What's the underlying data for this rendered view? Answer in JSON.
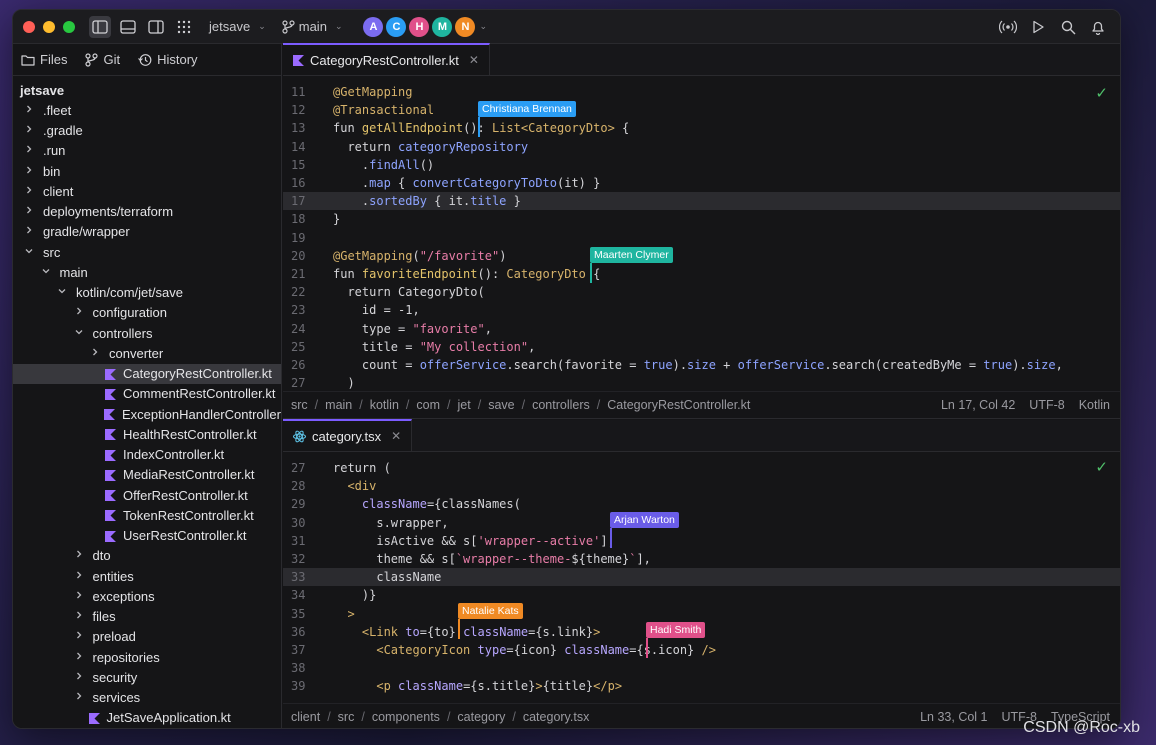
{
  "titlebar": {
    "project": "jetsave",
    "branch": "main",
    "avatars": [
      {
        "letter": "A",
        "color": "#7b6cf0"
      },
      {
        "letter": "C",
        "color": "#2a9df4"
      },
      {
        "letter": "H",
        "color": "#e0508a"
      },
      {
        "letter": "M",
        "color": "#1fb5a0"
      },
      {
        "letter": "N",
        "color": "#f08a24"
      }
    ],
    "icons_left": [
      "sidebar-left-icon",
      "panel-bottom-icon",
      "sidebar-right-icon",
      "grid-icon"
    ],
    "icons_right": [
      "broadcast-icon",
      "run-icon",
      "search-icon",
      "bell-icon"
    ]
  },
  "sidebar": {
    "tabs": [
      {
        "label": "Files",
        "icon": "folder-icon"
      },
      {
        "label": "Git",
        "icon": "git-branch-icon"
      },
      {
        "label": "History",
        "icon": "history-icon"
      }
    ],
    "root": "jetsave",
    "tree": [
      {
        "label": ".fleet",
        "depth": 0,
        "kind": "folder",
        "open": false
      },
      {
        "label": ".gradle",
        "depth": 0,
        "kind": "folder",
        "open": false
      },
      {
        "label": ".run",
        "depth": 0,
        "kind": "folder",
        "open": false
      },
      {
        "label": "bin",
        "depth": 0,
        "kind": "folder",
        "open": false
      },
      {
        "label": "client",
        "depth": 0,
        "kind": "folder",
        "open": false
      },
      {
        "label": "deployments/terraform",
        "depth": 0,
        "kind": "folder",
        "open": false
      },
      {
        "label": "gradle/wrapper",
        "depth": 0,
        "kind": "folder",
        "open": false
      },
      {
        "label": "src",
        "depth": 0,
        "kind": "folder",
        "open": true
      },
      {
        "label": "main",
        "depth": 1,
        "kind": "folder",
        "open": true
      },
      {
        "label": "kotlin/com/jet/save",
        "depth": 2,
        "kind": "folder",
        "open": true
      },
      {
        "label": "configuration",
        "depth": 3,
        "kind": "folder",
        "open": false
      },
      {
        "label": "controllers",
        "depth": 3,
        "kind": "folder",
        "open": true
      },
      {
        "label": "converter",
        "depth": 4,
        "kind": "folder",
        "open": false
      },
      {
        "label": "CategoryRestController.kt",
        "depth": 4,
        "kind": "kt",
        "selected": true
      },
      {
        "label": "CommentRestController.kt",
        "depth": 4,
        "kind": "kt"
      },
      {
        "label": "ExceptionHandlerController",
        "depth": 4,
        "kind": "kt"
      },
      {
        "label": "HealthRestController.kt",
        "depth": 4,
        "kind": "kt"
      },
      {
        "label": "IndexController.kt",
        "depth": 4,
        "kind": "kt"
      },
      {
        "label": "MediaRestController.kt",
        "depth": 4,
        "kind": "kt"
      },
      {
        "label": "OfferRestController.kt",
        "depth": 4,
        "kind": "kt"
      },
      {
        "label": "TokenRestController.kt",
        "depth": 4,
        "kind": "kt"
      },
      {
        "label": "UserRestController.kt",
        "depth": 4,
        "kind": "kt"
      },
      {
        "label": "dto",
        "depth": 3,
        "kind": "folder",
        "open": false
      },
      {
        "label": "entities",
        "depth": 3,
        "kind": "folder",
        "open": false
      },
      {
        "label": "exceptions",
        "depth": 3,
        "kind": "folder",
        "open": false
      },
      {
        "label": "files",
        "depth": 3,
        "kind": "folder",
        "open": false
      },
      {
        "label": "preload",
        "depth": 3,
        "kind": "folder",
        "open": false
      },
      {
        "label": "repositories",
        "depth": 3,
        "kind": "folder",
        "open": false
      },
      {
        "label": "security",
        "depth": 3,
        "kind": "folder",
        "open": false
      },
      {
        "label": "services",
        "depth": 3,
        "kind": "folder",
        "open": false
      },
      {
        "label": "JetSaveApplication.kt",
        "depth": 3,
        "kind": "kt"
      }
    ]
  },
  "editor_top": {
    "tab": "CategoryRestController.kt",
    "current_line": 17,
    "lines": [
      {
        "n": "11",
        "html": "<span class=\"an\">@GetMapping</span>"
      },
      {
        "n": "12",
        "html": "<span class=\"an\">@Transactional</span>"
      },
      {
        "n": "13",
        "html": "fun <span class=\"fn\">getAllEndpoint</span>(): <span class=\"ty\">List&lt;CategoryDto&gt;</span> {"
      },
      {
        "n": "14",
        "html": "  return <span class=\"pr\">categoryRepository</span>"
      },
      {
        "n": "15",
        "html": "    .<span class=\"pr\">findAll</span>()"
      },
      {
        "n": "16",
        "html": "    .<span class=\"pr\">map</span> { <span class=\"pr\">convertCategoryToDto</span>(it) }"
      },
      {
        "n": "17",
        "html": "    .<span class=\"pr\">sortedBy</span> { it.<span class=\"pr\">title</span> }"
      },
      {
        "n": "18",
        "html": "}"
      },
      {
        "n": "19",
        "html": ""
      },
      {
        "n": "20",
        "html": "<span class=\"an\">@GetMapping</span>(<span class=\"st\">\"/favorite\"</span>)"
      },
      {
        "n": "21",
        "html": "fun <span class=\"fn\">favoriteEndpoint</span>(): <span class=\"ty\">CategoryDto</span> {"
      },
      {
        "n": "22",
        "html": "  return CategoryDto("
      },
      {
        "n": "23",
        "html": "    id = -1,"
      },
      {
        "n": "24",
        "html": "    type = <span class=\"st\">\"favorite\"</span>,"
      },
      {
        "n": "25",
        "html": "    title = <span class=\"st\">\"My collection\"</span>,"
      },
      {
        "n": "26",
        "html": "    count = <span class=\"pr\">offerService</span>.search(favorite = <span class=\"bl\">true</span>).<span class=\"pr\">size</span> + <span class=\"pr\">offerService</span>.search(createdByMe = <span class=\"bl\">true</span>).<span class=\"pr\">size</span>,"
      },
      {
        "n": "27",
        "html": "  )"
      }
    ],
    "crumbs": [
      "src",
      "main",
      "kotlin",
      "com",
      "jet",
      "save",
      "controllers",
      "CategoryRestController.kt"
    ],
    "position": "Ln 17, Col 42",
    "encoding": "UTF-8",
    "language": "Kotlin",
    "cursors": [
      {
        "name": "Christiana Brennan",
        "color": "#2a9df4"
      },
      {
        "name": "Maarten Clymer",
        "color": "#1fb5a0"
      }
    ]
  },
  "editor_bottom": {
    "tab": "category.tsx",
    "current_line": 33,
    "lines": [
      {
        "n": "27",
        "html": "return ("
      },
      {
        "n": "28",
        "html": "  <span class=\"jx\">&lt;div</span>"
      },
      {
        "n": "29",
        "html": "    <span class=\"at\">className</span>={classNames("
      },
      {
        "n": "30",
        "html": "      s.wrapper,"
      },
      {
        "n": "31",
        "html": "      isActive &amp;&amp; s[<span class=\"st\">'wrapper--active'</span>],"
      },
      {
        "n": "32",
        "html": "      theme &amp;&amp; s[<span class=\"st\">`wrapper--theme-</span>${theme}<span class=\"st\">`</span>],"
      },
      {
        "n": "33",
        "html": "      className"
      },
      {
        "n": "34",
        "html": "    )}"
      },
      {
        "n": "35",
        "html": "  <span class=\"jx\">&gt;</span>"
      },
      {
        "n": "36",
        "html": "    <span class=\"jx\">&lt;Link</span> <span class=\"at\">to</span>={to} <span class=\"at\">className</span>={s.link}<span class=\"jx\">&gt;</span>"
      },
      {
        "n": "37",
        "html": "      <span class=\"jx\">&lt;CategoryIcon</span> <span class=\"at\">type</span>={icon} <span class=\"at\">className</span>={s.icon} <span class=\"jx\">/&gt;</span>"
      },
      {
        "n": "38",
        "html": ""
      },
      {
        "n": "39",
        "html": "      <span class=\"jx\">&lt;p</span> <span class=\"at\">className</span>={s.title}<span class=\"jx\">&gt;</span>{title}<span class=\"jx\">&lt;/p&gt;</span>"
      }
    ],
    "crumbs": [
      "client",
      "src",
      "components",
      "category",
      "category.tsx"
    ],
    "position": "Ln 33, Col 1",
    "encoding": "UTF-8",
    "language": "TypeScript",
    "cursors": [
      {
        "name": "Arjan Warton",
        "color": "#6a5ce8"
      },
      {
        "name": "Natalie Kats",
        "color": "#f08a24"
      },
      {
        "name": "Hadi Smith",
        "color": "#e0508a"
      }
    ]
  },
  "watermark": "CSDN @Roc-xb"
}
